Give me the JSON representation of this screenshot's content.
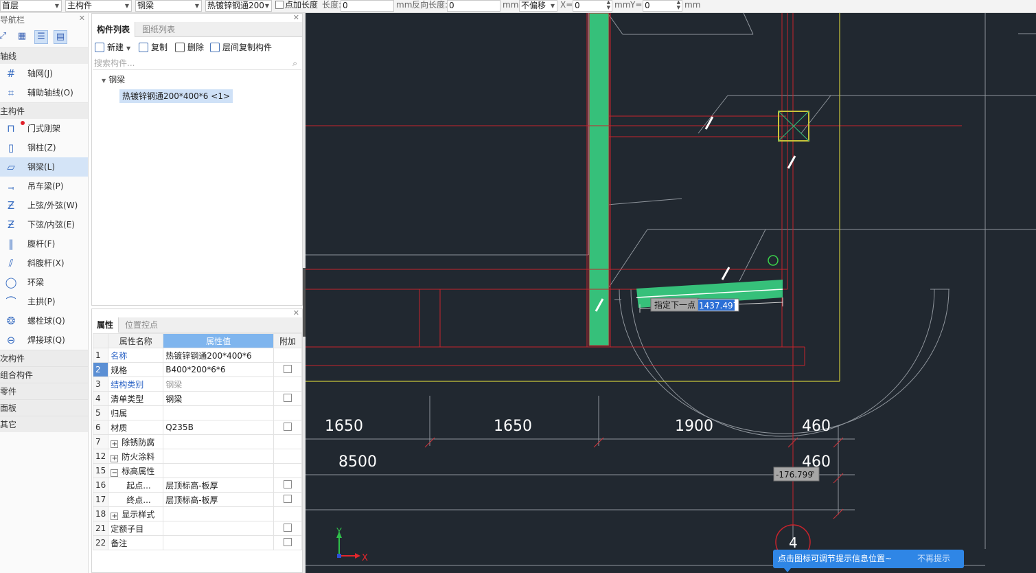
{
  "toolbar": {
    "floor": "首层",
    "category": "主构件",
    "type": "钢梁",
    "component": "热镀锌钢通200",
    "point_length_label": "点加长度",
    "length_label": "长度:",
    "length_value": "0",
    "unit1": "mm",
    "reverse_length_label": "反向长度:",
    "reverse_length_value": "0",
    "unit2": "mm",
    "offset_mode": "不偏移",
    "x_label": "X=",
    "x_value": "0",
    "unit3": "mm",
    "y_label": "Y=",
    "y_value": "0",
    "unit4": "mm"
  },
  "nav": {
    "title": "导航栏",
    "sections": {
      "axis": "轴线",
      "main": "主构件",
      "secondary": "次构件",
      "composite": "组合构件",
      "parts": "零件",
      "panel": "面板",
      "other": "其它"
    },
    "axis_items": [
      {
        "label": "轴网(J)",
        "icon": "grid-icon"
      },
      {
        "label": "辅助轴线(O)",
        "icon": "aux-axis-icon"
      }
    ],
    "main_items": [
      {
        "label": "门式刚架",
        "icon": "portal-frame-icon"
      },
      {
        "label": "钢柱(Z)",
        "icon": "steel-column-icon"
      },
      {
        "label": "钢梁(L)",
        "icon": "steel-beam-icon"
      },
      {
        "label": "吊车梁(P)",
        "icon": "crane-beam-icon"
      },
      {
        "label": "上弦/外弦(W)",
        "icon": "upper-chord-icon"
      },
      {
        "label": "下弦/内弦(E)",
        "icon": "lower-chord-icon"
      },
      {
        "label": "腹杆(F)",
        "icon": "web-member-icon"
      },
      {
        "label": "斜腹杆(X)",
        "icon": "diagonal-web-icon"
      },
      {
        "label": "环梁",
        "icon": "ring-beam-icon"
      },
      {
        "label": "主拱(P)",
        "icon": "main-arch-icon"
      },
      {
        "label": "螺栓球(Q)",
        "icon": "bolt-ball-icon"
      },
      {
        "label": "焊接球(Q)",
        "icon": "weld-ball-icon"
      }
    ]
  },
  "component_panel": {
    "tab_components": "构件列表",
    "tab_drawings": "图纸列表",
    "new": "新建",
    "copy": "复制",
    "delete": "删除",
    "copy_between_floors": "层间复制构件",
    "search_placeholder": "搜索构件...",
    "tree_group": "钢梁",
    "tree_item": "热镀锌钢通200*400*6 <1>"
  },
  "property_panel": {
    "tab_props": "属性",
    "tab_anchor": "位置控点",
    "col_name": "属性名称",
    "col_value": "属性值",
    "col_extra": "附加",
    "rows": [
      {
        "num": "1",
        "name": "名称",
        "value": "热镀锌钢通200*400*6"
      },
      {
        "num": "2",
        "name": "规格",
        "value": "B400*200*6*6"
      },
      {
        "num": "3",
        "name": "结构类别",
        "value": "钢梁"
      },
      {
        "num": "4",
        "name": "清单类型",
        "value": "钢梁"
      },
      {
        "num": "5",
        "name": "归属",
        "value": ""
      },
      {
        "num": "6",
        "name": "材质",
        "value": "Q235B"
      },
      {
        "num": "7",
        "name": "除锈防腐",
        "value": ""
      },
      {
        "num": "12",
        "name": "防火涂料",
        "value": ""
      },
      {
        "num": "15",
        "name": "标高属性",
        "value": ""
      },
      {
        "num": "16",
        "name": "起点...",
        "value": "层顶标高-板厚"
      },
      {
        "num": "17",
        "name": "终点...",
        "value": "层顶标高-板厚"
      },
      {
        "num": "18",
        "name": "显示样式",
        "value": ""
      },
      {
        "num": "21",
        "name": "定额子目",
        "value": ""
      },
      {
        "num": "22",
        "name": "备注",
        "value": ""
      }
    ]
  },
  "canvas": {
    "prompt": "指定下一点",
    "length_input": "1437.497",
    "angle_value": "-176.799",
    "angle_unit": "°",
    "dims_row1": [
      "1650",
      "1650",
      "1900",
      "460"
    ],
    "dims_row2": [
      "8500",
      "460"
    ],
    "axis_bubble": "4",
    "axis_x": "X",
    "axis_y": "Y",
    "tooltip_message": "点击图标可调节提示信息位置~",
    "tooltip_dismiss": "不再提示"
  },
  "colors": {
    "canvas_bg": "#212830",
    "beam_green": "#36c07a",
    "axis_red": "#c8232c",
    "boundary_yellow": "#c8c43a",
    "tooltip_blue": "#2f86e6"
  }
}
